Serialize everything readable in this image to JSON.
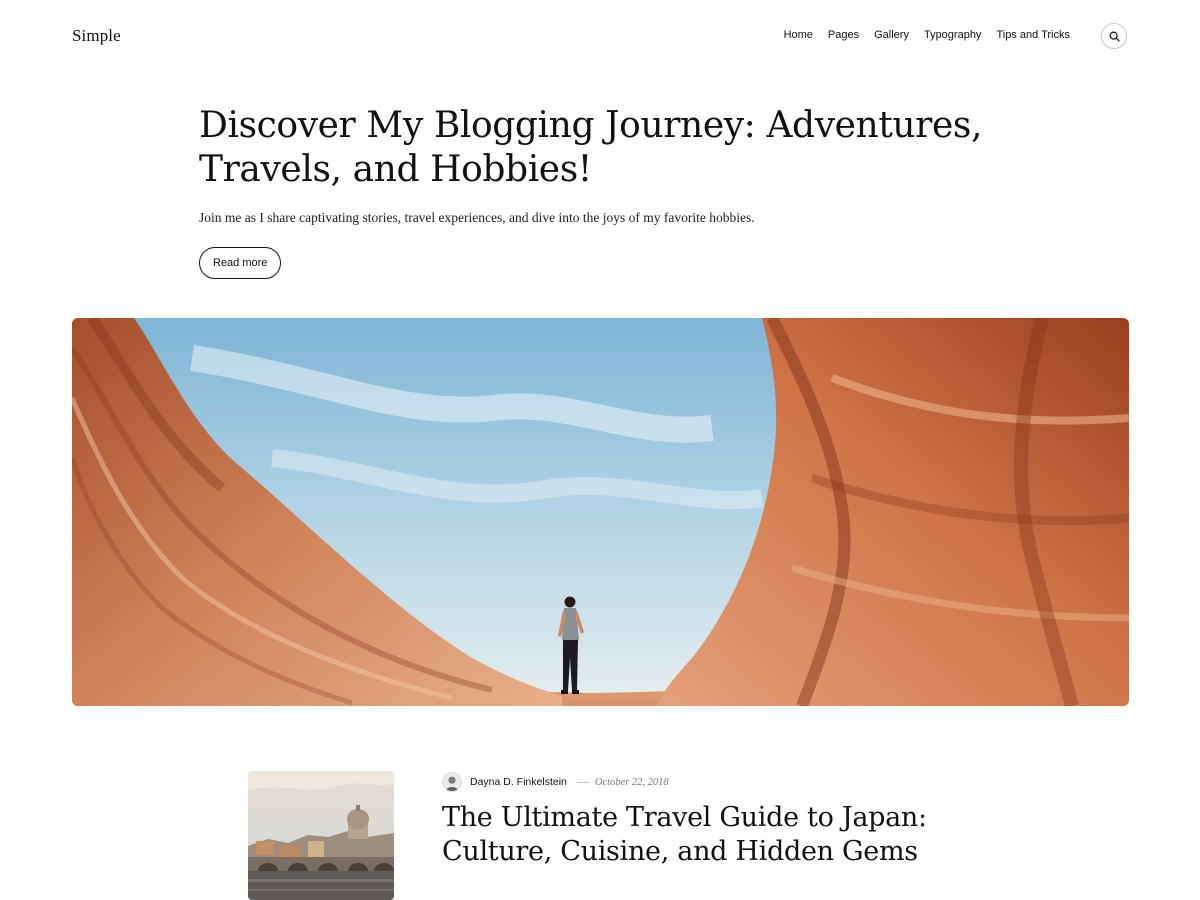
{
  "header": {
    "site_title": "Simple",
    "nav": [
      {
        "label": "Home"
      },
      {
        "label": "Pages"
      },
      {
        "label": "Gallery"
      },
      {
        "label": "Typography"
      },
      {
        "label": "Tips and Tricks"
      }
    ],
    "search_icon": "search-icon"
  },
  "hero": {
    "title_line1": "Discover My Blogging Journey: Adventures,",
    "title_line2": "Travels, and Hobbies!",
    "subtitle": "Join me as I share captivating stories, travel experiences, and dive into the joys of my favorite hobbies.",
    "button_label": "Read more",
    "image": "canyon-photo"
  },
  "post": {
    "thumbnail": "rome-cityscape-photo",
    "author": "Dayna D. Finkelstein",
    "date": "October 22, 2018",
    "title_line1": "The Ultimate Travel Guide to Japan:",
    "title_line2": "Culture, Cuisine, and Hidden Gems"
  },
  "colors": {
    "text": "#111111",
    "muted": "#777777",
    "background": "#ffffff"
  }
}
